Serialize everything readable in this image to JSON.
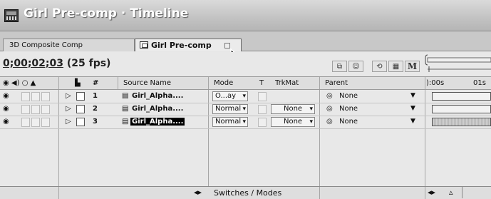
{
  "window": {
    "title": "Girl Pre-comp · Timeline"
  },
  "tabs": [
    {
      "label": "3D Composite Comp",
      "active": false
    },
    {
      "label": "Girl Pre-comp",
      "active": true
    }
  ],
  "toolbar": {
    "timecode": "0;00;02;03",
    "fps": "(25 fps)",
    "m_label": "M"
  },
  "timeline": {
    "tick_0": "):00s",
    "tick_1": "01s"
  },
  "columns": {
    "hash": "#",
    "source_name": "Source Name",
    "mode": "Mode",
    "t": "T",
    "trkmat": "TrkMat",
    "parent": "Parent"
  },
  "layers": [
    {
      "num": "1",
      "name": "Girl_Alpha....",
      "mode": "O...ay",
      "trkmat": "",
      "parent": "None",
      "selected": false
    },
    {
      "num": "2",
      "name": "Girl_Alpha....",
      "mode": "Normal",
      "trkmat": "None",
      "parent": "None",
      "selected": false
    },
    {
      "num": "3",
      "name": "Girl_Alpha....",
      "mode": "Normal",
      "trkmat": "None",
      "parent": "None",
      "selected": true
    }
  ],
  "bottom": {
    "switches_modes": "Switches / Modes"
  },
  "icons": {
    "title": "composition-timeline-icon",
    "tab": "composition-icon",
    "cursor": "mouse-pointer-icon",
    "eye": "eye-icon",
    "audio": "speaker-icon",
    "solo": "solo-icon",
    "lock": "lock-icon",
    "label": "label-icon",
    "layer_source": "footage-icon",
    "parent_pickwhip": "pickwhip-icon"
  }
}
